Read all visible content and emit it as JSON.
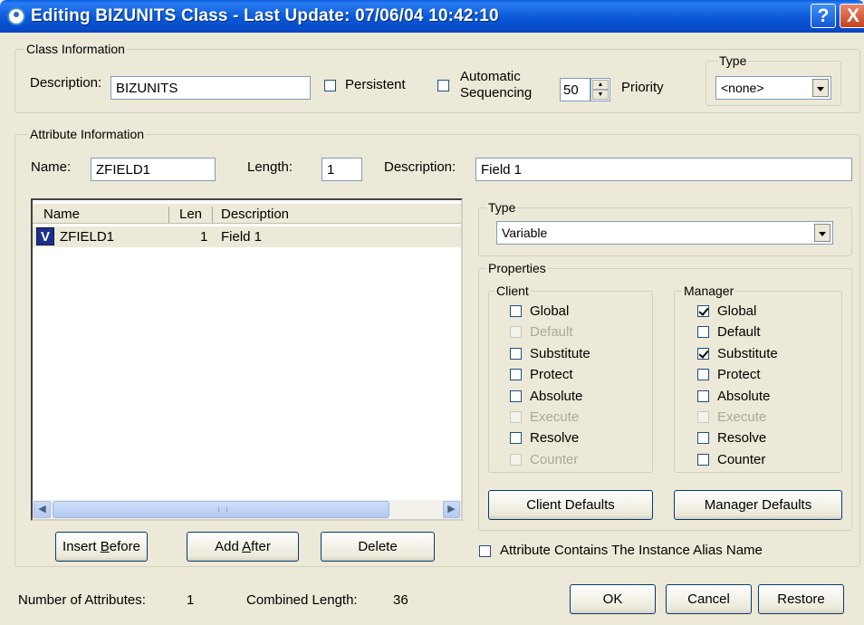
{
  "window": {
    "title": "Editing BIZUNITS Class   - Last Update: 07/06/04 10:42:10",
    "help_label": "?",
    "close_label": "X"
  },
  "class_info": {
    "legend": "Class Information",
    "description_label": "Description:",
    "description_value": "BIZUNITS",
    "persistent_label": "Persistent",
    "persistent_checked": false,
    "auto_seq_line1": "Automatic",
    "auto_seq_line2": "Sequencing",
    "auto_seq_checked": false,
    "priority_value": "50",
    "priority_label": "Priority",
    "type_legend": "Type",
    "type_value": "<none>"
  },
  "attribute_info": {
    "legend": "Attribute Information",
    "name_label": "Name:",
    "name_value": "ZFIELD1",
    "length_label": "Length:",
    "length_value": "1",
    "description_label": "Description:",
    "description_value": "Field 1"
  },
  "attribute_list": {
    "columns": [
      "Name",
      "Len",
      "Description"
    ],
    "rows": [
      {
        "icon": "V",
        "name": "ZFIELD1",
        "len": "1",
        "description": "Field 1"
      }
    ]
  },
  "type_group": {
    "legend": "Type",
    "value": "Variable"
  },
  "properties": {
    "legend": "Properties",
    "client": {
      "legend": "Client",
      "items": [
        {
          "label": "Global",
          "checked": false,
          "enabled": true
        },
        {
          "label": "Default",
          "checked": false,
          "enabled": false
        },
        {
          "label": "Substitute",
          "checked": false,
          "enabled": true
        },
        {
          "label": "Protect",
          "checked": false,
          "enabled": true
        },
        {
          "label": "Absolute",
          "checked": false,
          "enabled": true
        },
        {
          "label": "Execute",
          "checked": false,
          "enabled": false
        },
        {
          "label": "Resolve",
          "checked": false,
          "enabled": true
        },
        {
          "label": "Counter",
          "checked": false,
          "enabled": false
        }
      ]
    },
    "manager": {
      "legend": "Manager",
      "items": [
        {
          "label": "Global",
          "checked": true,
          "enabled": true
        },
        {
          "label": "Default",
          "checked": false,
          "enabled": true
        },
        {
          "label": "Substitute",
          "checked": true,
          "enabled": true
        },
        {
          "label": "Protect",
          "checked": false,
          "enabled": true
        },
        {
          "label": "Absolute",
          "checked": false,
          "enabled": true
        },
        {
          "label": "Execute",
          "checked": false,
          "enabled": false
        },
        {
          "label": "Resolve",
          "checked": false,
          "enabled": true
        },
        {
          "label": "Counter",
          "checked": false,
          "enabled": true
        }
      ]
    }
  },
  "buttons": {
    "client_defaults": "Client Defaults",
    "manager_defaults": "Manager Defaults",
    "insert_before_pre": "Insert ",
    "insert_before_key": "B",
    "insert_before_post": "efore",
    "add_after_pre": "Add ",
    "add_after_key": "A",
    "add_after_post": "fter",
    "delete": "Delete",
    "ok": "OK",
    "cancel": "Cancel",
    "restore": "Restore"
  },
  "instance_alias": {
    "label": "Attribute Contains The Instance Alias Name",
    "checked": false
  },
  "footer": {
    "num_attributes_label": "Number of Attributes:",
    "num_attributes_value": "1",
    "combined_length_label": "Combined Length:",
    "combined_length_value": "36"
  }
}
